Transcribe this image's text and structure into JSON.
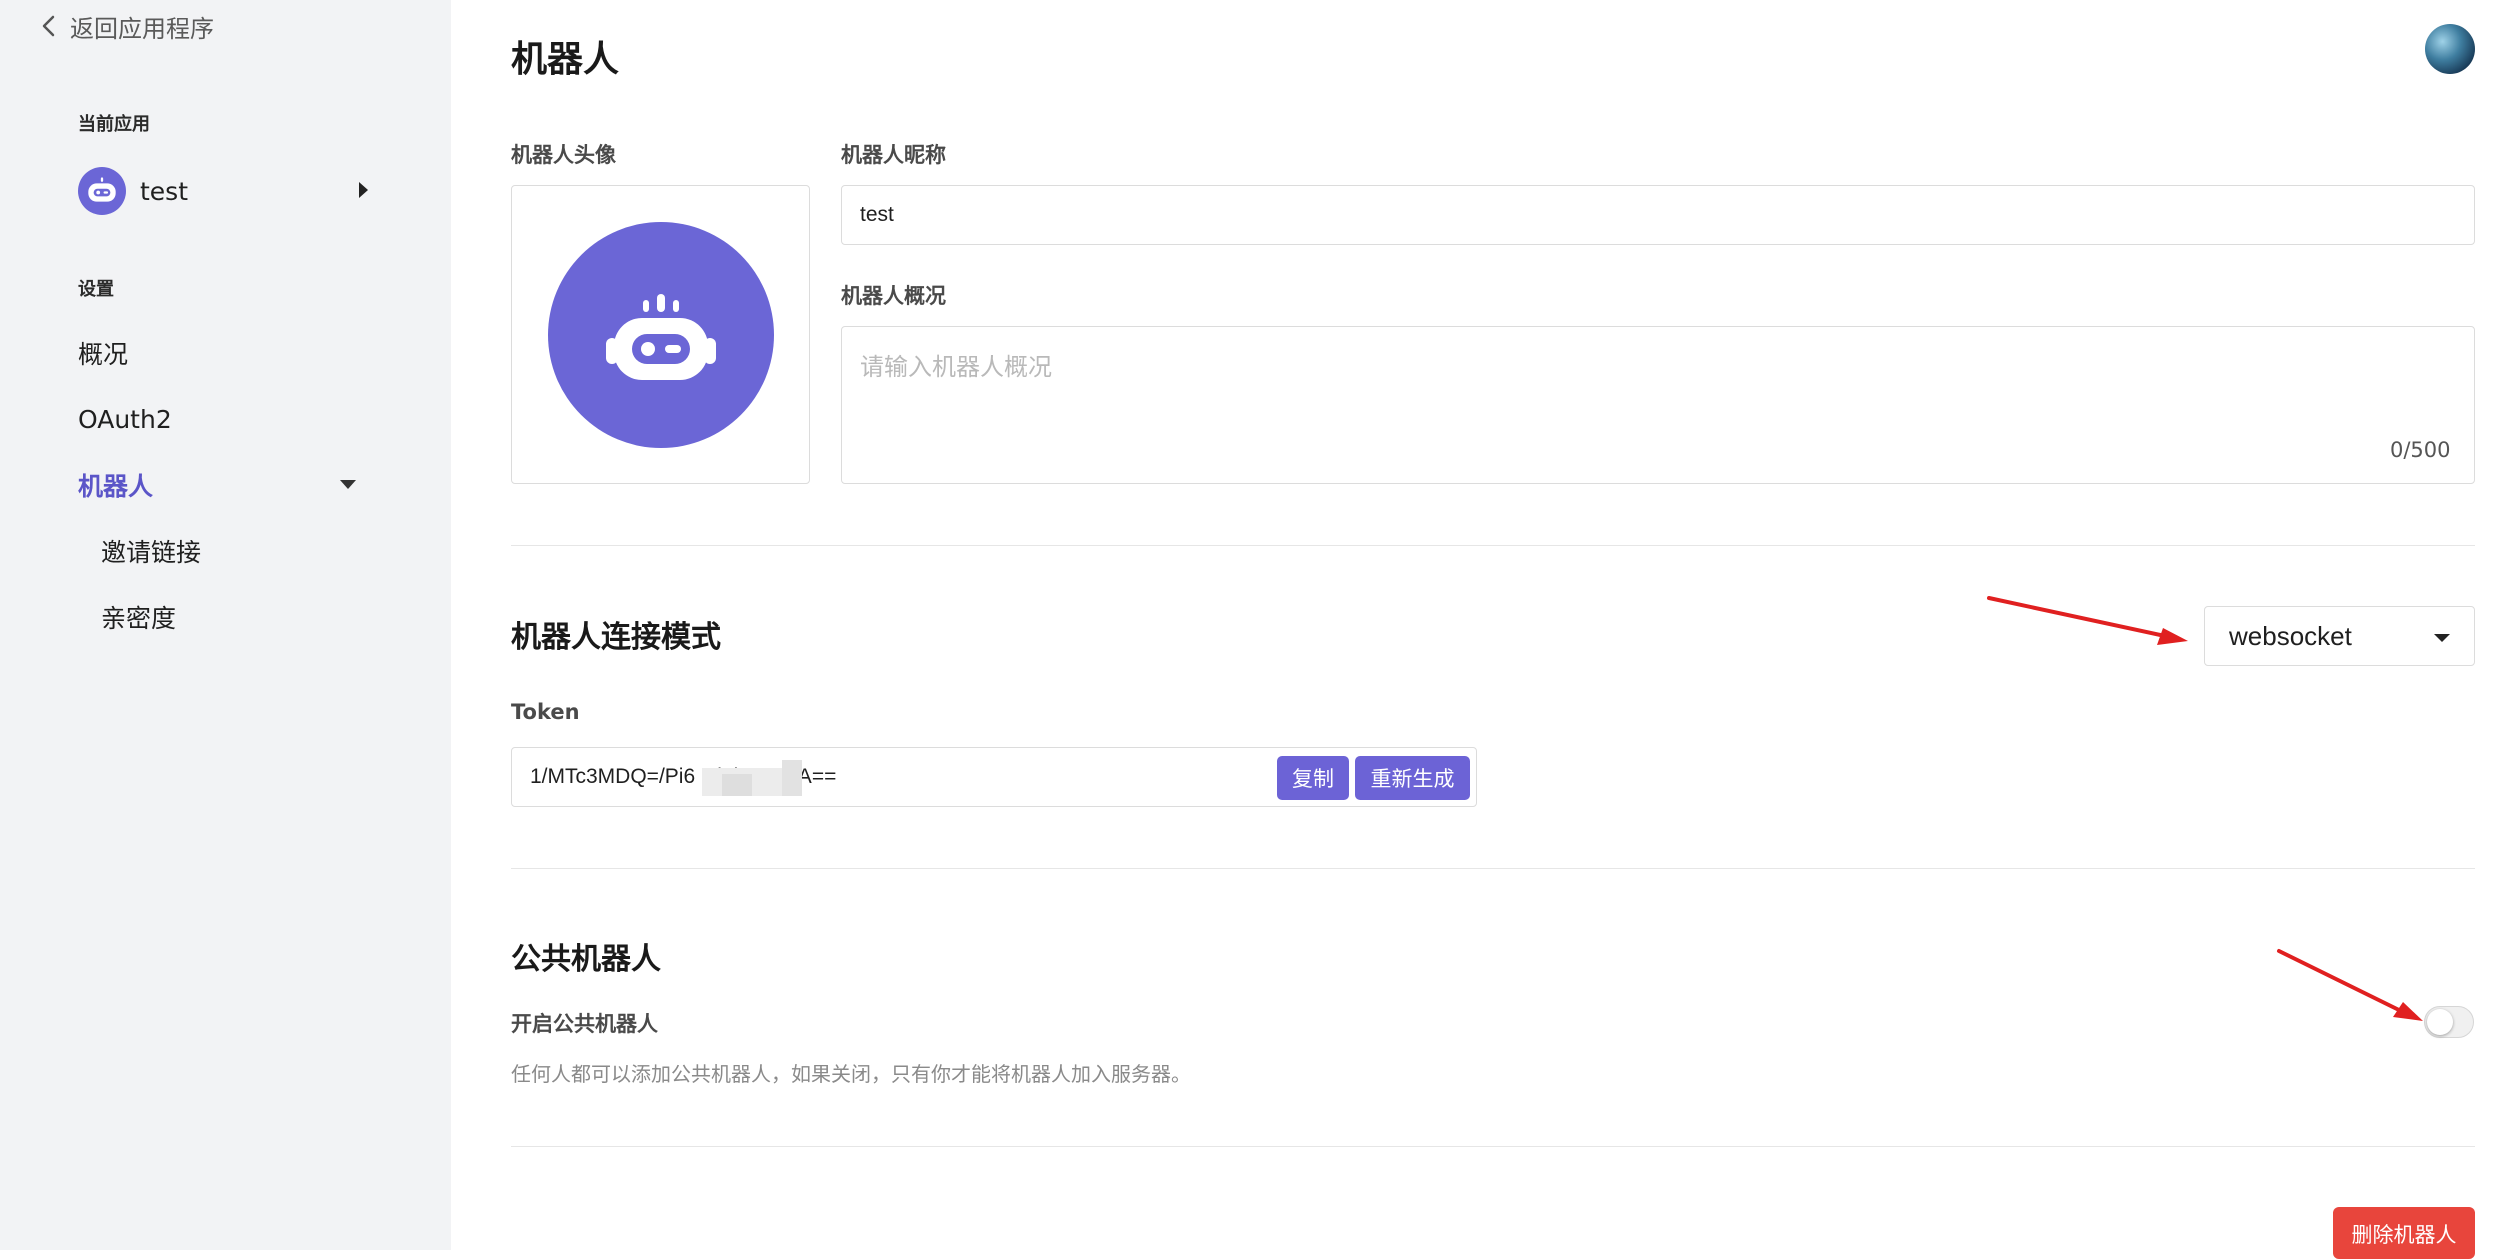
{
  "sidebar": {
    "back_label": "返回应用程序",
    "current_app_heading": "当前应用",
    "current_app_name": "test",
    "settings_heading": "设置",
    "items": [
      {
        "label": "概况"
      },
      {
        "label": "OAuth2"
      },
      {
        "label": "机器人"
      },
      {
        "label": "邀请链接"
      },
      {
        "label": "亲密度"
      }
    ]
  },
  "main": {
    "title": "机器人",
    "avatar_label": "机器人头像",
    "nickname_label": "机器人昵称",
    "nickname_value": "test",
    "overview_label": "机器人概况",
    "overview_placeholder": "请输入机器人概况",
    "overview_count": "0/500",
    "connection": {
      "title": "机器人连接模式",
      "mode_value": "websocket",
      "token_label": "Token",
      "token_value": "1/MTc3MDQ=/Pi6              Gi9j5MCCA==",
      "copy_label": "复制",
      "regenerate_label": "重新生成"
    },
    "public": {
      "title": "公共机器人",
      "toggle_label": "开启公共机器人",
      "toggle_on": false,
      "hint": "任何人都可以添加公共机器人，如果关闭，只有你才能将机器人加入服务器。"
    },
    "delete_label": "删除机器人"
  },
  "colors": {
    "accent": "#6c63d6",
    "avatar_bg": "#6b66d6",
    "danger": "#e8453c",
    "annotation_arrow": "#e02020",
    "sidebar_bg": "#f2f3f5"
  }
}
